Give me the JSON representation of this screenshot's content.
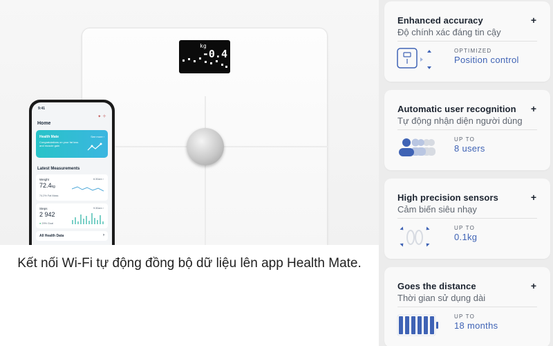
{
  "caption": "Kết nối Wi-Fi tự động đồng bộ dữ liệu lên app Health Mate.",
  "scale": {
    "display_unit": "kg",
    "display_reading": "-0.4"
  },
  "phone": {
    "status_time": "9:41",
    "home_title": "Home",
    "health_mate_card": {
      "title": "Health Mate",
      "subtitle": "Congratulations on your fat loss and muscle gain",
      "link": "See more ›"
    },
    "latest_title": "Latest Measurements",
    "weight": {
      "label": "Weight",
      "value": "72.4",
      "unit": "kg",
      "note": "74.2% Fat Mass",
      "when": "6:30am ›"
    },
    "steps": {
      "label": "Steps",
      "value": "2 942",
      "note": "29% Goal",
      "when": "9:30am ›"
    },
    "all_health_data": "All Health Data"
  },
  "features": [
    {
      "title": "Enhanced accuracy",
      "subtitle": "Độ chính xác đáng tin cậy",
      "plus": "+",
      "small": "OPTIMIZED",
      "value": "Position control",
      "icon": "position-control-icon"
    },
    {
      "title": "Automatic user recognition",
      "subtitle": "Tự động nhận diện người dùng",
      "plus": "+",
      "small": "UP TO",
      "value": "8 users",
      "icon": "users-icon"
    },
    {
      "title": "High precision sensors",
      "subtitle": "Cảm biến siêu nhạy",
      "plus": "+",
      "small": "UP TO",
      "value": "0.1kg",
      "icon": "footprints-icon"
    },
    {
      "title": "Goes the distance",
      "subtitle": "Thời gian sử dụng dài",
      "plus": "+",
      "small": "UP TO",
      "value": "18 months",
      "icon": "battery-icon"
    }
  ],
  "colors": {
    "accent": "#3f63b5",
    "teal": "#28c3c8",
    "panel": "#ececec",
    "card": "#f9f9f9"
  }
}
